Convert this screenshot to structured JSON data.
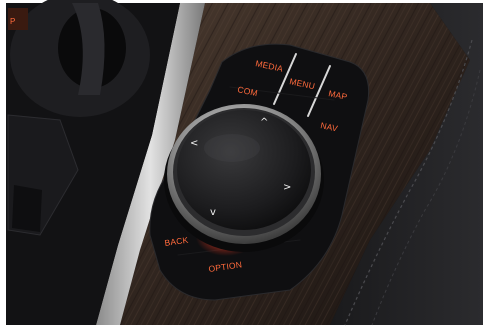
{
  "image": {
    "subject": "iDrive controller knob",
    "buttons": {
      "media": "MEDIA",
      "menu": "MENU",
      "map": "MAP",
      "com": "COM",
      "nav": "NAV",
      "back": "BACK",
      "option": "OPTION"
    },
    "knob": {
      "arrows": {
        "up": "^",
        "down": "v",
        "left": "<",
        "right": ">"
      }
    },
    "colors": {
      "backlight": "#ff6a3c",
      "console_black": "#0b0b0c",
      "trim_wood": "#3b2c22",
      "trim_silver": "#c9c9c9"
    }
  }
}
